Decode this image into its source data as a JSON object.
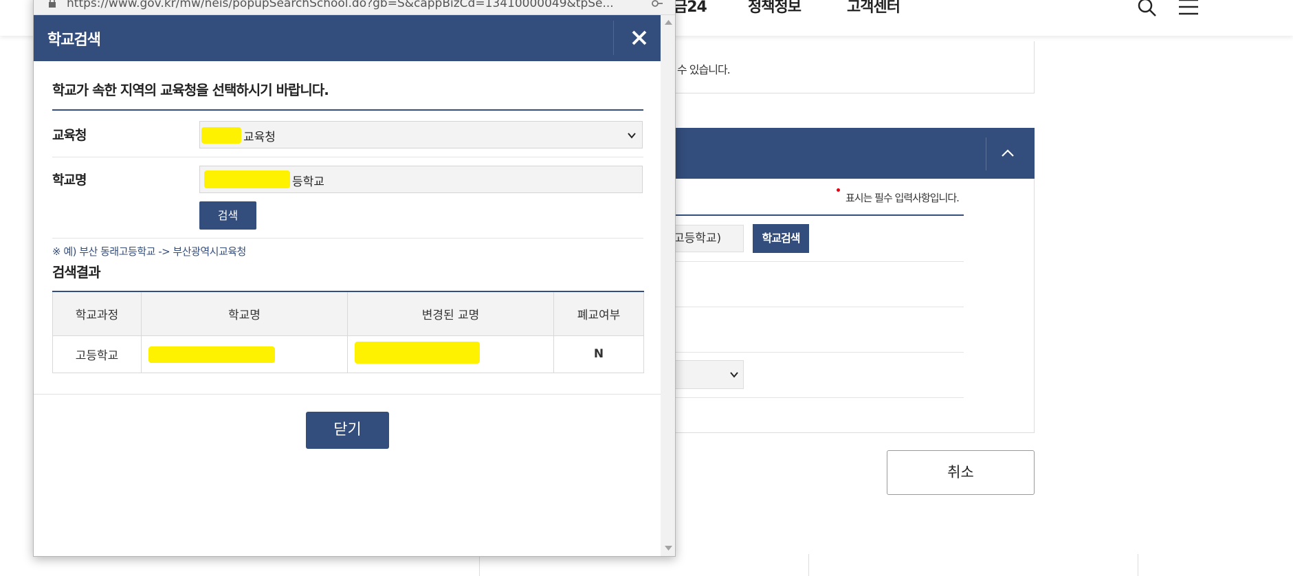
{
  "background": {
    "nav": [
      "금24",
      "정책정보",
      "고객센터"
    ],
    "notice_fragment": "수 있습니다.",
    "required_note": "표시는 필수 입력사항입니다.",
    "school_input_value": "고등학교)",
    "school_search_button": "학교검색",
    "cancel_button": "취소"
  },
  "popup": {
    "url": "https://www.gov.kr/mw/neis/popupSearchSchool.do?gb=S&cappBizCd=13410000049&tpSe...",
    "title": "학교검색",
    "intro": "학교가 속한 지역의 교육청을 선택하시기 바랍니다.",
    "office_label": "교육청",
    "office_value_suffix": "교육청",
    "school_name_label": "학교명",
    "school_name_value_suffix": "등학교",
    "search_button": "검색",
    "example": "※ 예) 부산 동래고등학교 -> 부산광역시교육청",
    "results_title": "검색결과",
    "table": {
      "headers": [
        "학교과정",
        "학교명",
        "변경된 교명",
        "폐교여부"
      ],
      "rows": [
        {
          "course": "고등학교",
          "closed": "N"
        }
      ]
    },
    "close_button": "닫기"
  },
  "colors": {
    "primary": "#334d7c",
    "redaction": "#fff200",
    "required": "#e60012"
  },
  "icons": [
    "search-icon",
    "menu-icon",
    "chevron-up-icon",
    "chevron-down-icon",
    "close-icon",
    "lock-icon",
    "key-icon"
  ]
}
